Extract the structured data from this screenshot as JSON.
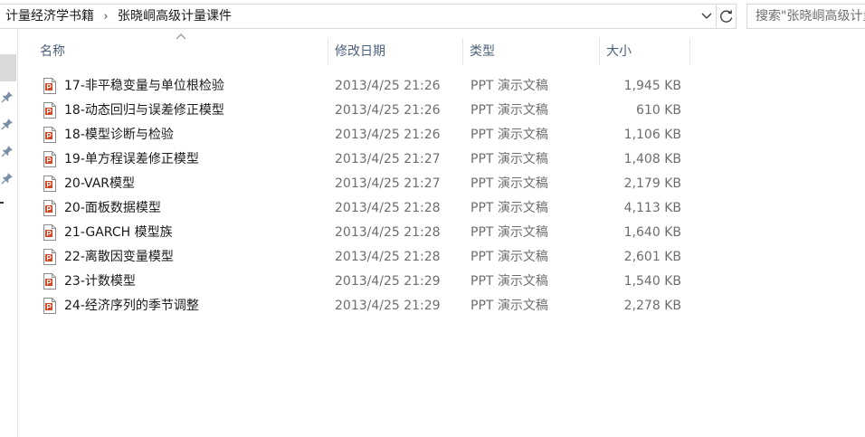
{
  "address_bar": {
    "breadcrumbs": [
      "计量经济学书籍",
      "张晓峒高级计量课件"
    ],
    "separator": "›"
  },
  "search": {
    "placeholder": "搜索\"张晓峒高级计量课件\""
  },
  "columns": {
    "name": "名称",
    "date": "修改日期",
    "type": "类型",
    "size": "大小",
    "sorted_by": "name",
    "sort_direction": "ascending"
  },
  "files": [
    {
      "name": "17-非平稳变量与单位根检验",
      "date": "2013/4/25 21:26",
      "type": "PPT 演示文稿",
      "size": "1,945 KB"
    },
    {
      "name": "18-动态回归与误差修正模型",
      "date": "2013/4/25 21:26",
      "type": "PPT 演示文稿",
      "size": "610 KB"
    },
    {
      "name": "18-模型诊断与检验",
      "date": "2013/4/25 21:26",
      "type": "PPT 演示文稿",
      "size": "1,106 KB"
    },
    {
      "name": "19-单方程误差修正模型",
      "date": "2013/4/25 21:27",
      "type": "PPT 演示文稿",
      "size": "1,408 KB"
    },
    {
      "name": "20-VAR模型",
      "date": "2013/4/25 21:27",
      "type": "PPT 演示文稿",
      "size": "2,179 KB"
    },
    {
      "name": "20-面板数据模型",
      "date": "2013/4/25 21:28",
      "type": "PPT 演示文稿",
      "size": "4,113 KB"
    },
    {
      "name": "21-GARCH 模型族",
      "date": "2013/4/25 21:28",
      "type": "PPT 演示文稿",
      "size": "1,640 KB"
    },
    {
      "name": "22-离散因变量模型",
      "date": "2013/4/25 21:28",
      "type": "PPT 演示文稿",
      "size": "2,601 KB"
    },
    {
      "name": "23-计数模型",
      "date": "2013/4/25 21:29",
      "type": "PPT 演示文稿",
      "size": "1,540 KB"
    },
    {
      "name": "24-经济序列的季节调整",
      "date": "2013/4/25 21:29",
      "type": "PPT 演示文稿",
      "size": "2,278 KB"
    }
  ],
  "icons": {
    "file": "ppt-file-icon",
    "pin": "pin-icon",
    "dropdown": "chevron-down-icon",
    "refresh": "refresh-icon",
    "sort": "sort-ascending-icon"
  },
  "colors": {
    "header_text": "#4c607a",
    "meta_text": "#6d6d6d",
    "ppt_accent": "#d24726"
  }
}
